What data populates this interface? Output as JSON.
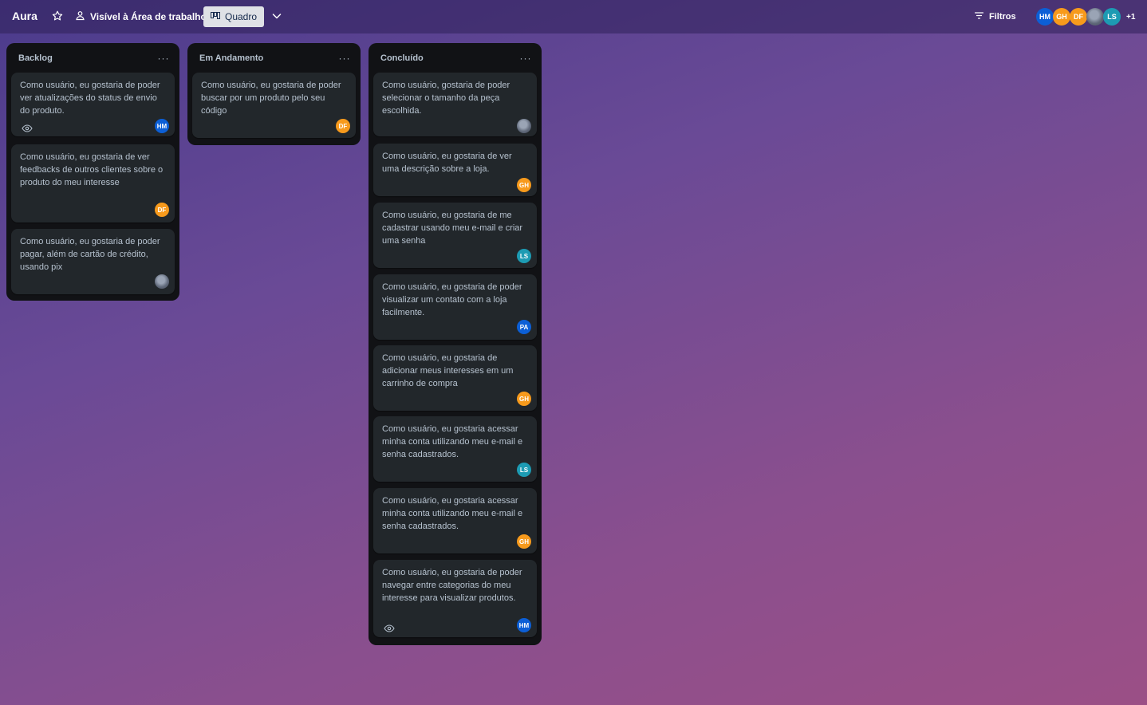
{
  "header": {
    "board_title": "Aura",
    "visibility_label": "Visível à Área de trabalho",
    "view_label": "Quadro",
    "filters_label": "Filtros",
    "members": [
      {
        "initials": "HM",
        "color": "#0c5fd6"
      },
      {
        "initials": "GH",
        "color": "#f79a1c"
      },
      {
        "initials": "DF",
        "color": "#f79a1c"
      },
      {
        "initials": "",
        "color": "#6b778c",
        "photo": true
      },
      {
        "initials": "LS",
        "color": "#1d9bb3"
      }
    ],
    "more_members": "+1"
  },
  "colors": {
    "hm": "#0c5fd6",
    "orange": "#f79a1c",
    "teal": "#1d9bb3",
    "list_bg": "#111215",
    "card_bg": "#22272b"
  },
  "lists": [
    {
      "title": "Backlog",
      "menu": "···",
      "cards": [
        {
          "text": "Como usuário, eu gostaria de poder ver atualizações do status de envio do produto.",
          "member": "HM",
          "watch": true
        },
        {
          "text": "Como usuário, eu gostaria de ver feedbacks de outros clientes sobre o produto do meu interesse",
          "member": "DF"
        },
        {
          "text": "Como usuário, eu gostaria de poder pagar, além de cartão de crédito, usando pix",
          "member": ""
        }
      ]
    },
    {
      "title": "Em Andamento",
      "menu": "···",
      "cards": [
        {
          "text": "Como usuário, eu gostaria de poder buscar por um produto pelo seu código",
          "member": "DF"
        }
      ]
    },
    {
      "title": "Concluído",
      "menu": "···",
      "cards": [
        {
          "text": "Como usuário, gostaria de poder selecionar o tamanho da peça escolhida.",
          "member": ""
        },
        {
          "text": "Como usuário, eu gostaria de ver uma descrição sobre a loja.",
          "member": "GH"
        },
        {
          "text": "Como usuário, eu gostaria de me cadastrar usando meu e-mail e criar uma senha",
          "member": "LS"
        },
        {
          "text": "Como usuário, eu gostaria de poder visualizar um contato com a loja facilmente.",
          "member": "PA"
        },
        {
          "text": "Como usuário, eu gostaria de adicionar meus interesses em um carrinho de compra",
          "member": "GH"
        },
        {
          "text": "Como usuário, eu gostaria acessar minha conta utilizando meu e-mail e senha cadastrados.",
          "member": "LS"
        },
        {
          "text": "Como usuário, eu gostaria acessar minha conta utilizando meu e-mail e senha cadastrados.",
          "member": "GH"
        },
        {
          "text": "Como usuário, eu gostaria de poder navegar entre categorias do meu interesse para visualizar produtos.",
          "member": "HM",
          "watch": true
        }
      ]
    }
  ]
}
